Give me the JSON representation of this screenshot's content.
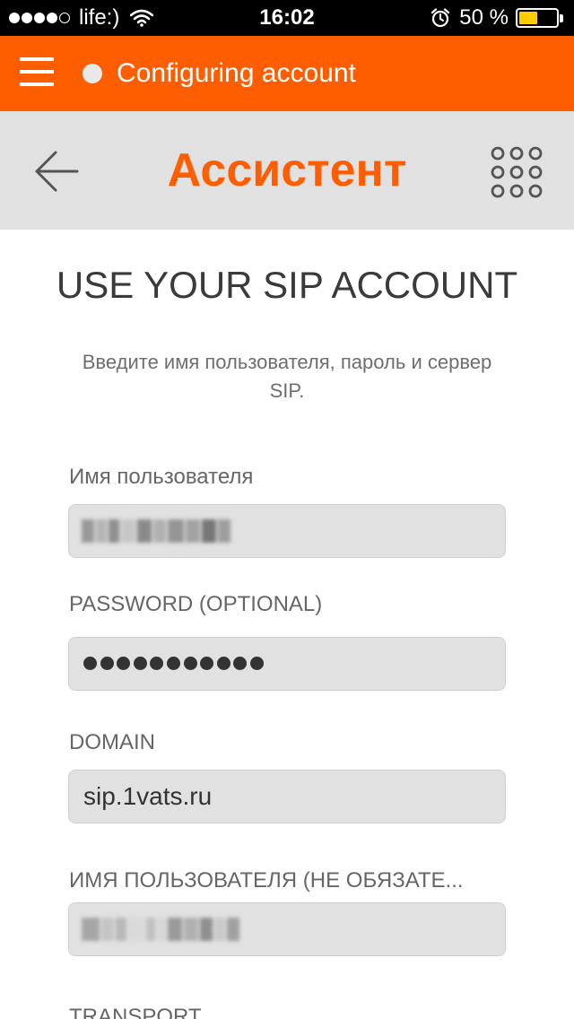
{
  "status_bar": {
    "carrier": "life:)",
    "time": "16:02",
    "battery_percent": "50 %",
    "battery_level": 0.5
  },
  "top_bar": {
    "title": "Configuring account"
  },
  "toolbar": {
    "title": "Ассистент"
  },
  "main": {
    "heading": "USE YOUR SIP ACCOUNT",
    "subtitle": "Введите имя пользователя, пароль и сервер SIP.",
    "fields": {
      "username_label": "Имя пользователя",
      "password_label": "PASSWORD (OPTIONAL)",
      "domain_label": "DOMAIN",
      "domain_value": "sip.1vats.ru",
      "display_name_label": "ИМЯ ПОЛЬЗОВАТЕЛЯ (НЕ ОБЯЗАТЕ...",
      "transport_label": "TRANSPORT"
    }
  },
  "colors": {
    "accent": "#ff5e00",
    "toolbar_bg": "#e1e1e1",
    "field_bg": "#e1e1e1"
  }
}
